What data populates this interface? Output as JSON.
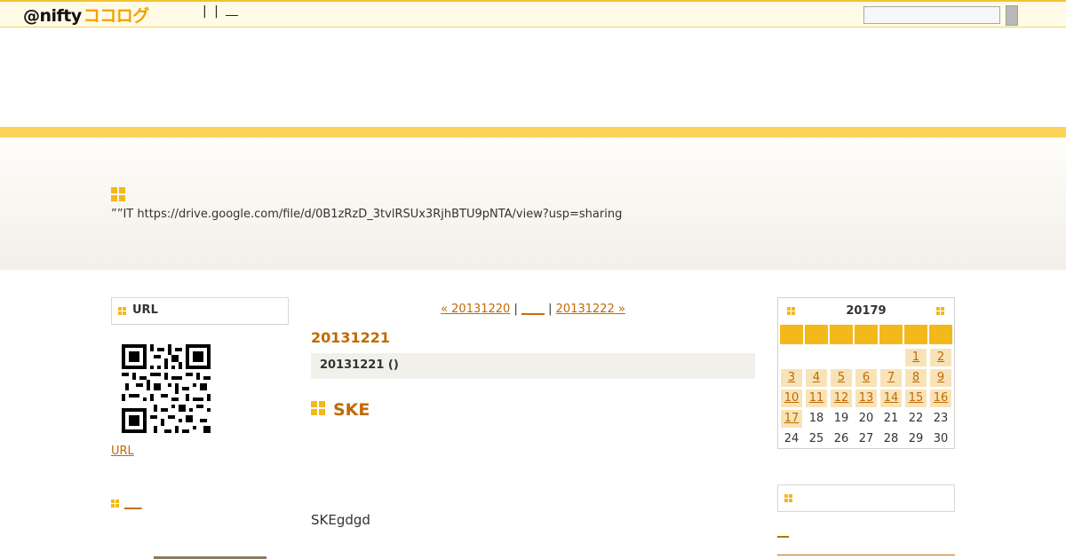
{
  "topbar": {
    "logo_prefix": "@nifty",
    "logo_brand": "ココログ",
    "links": [
      "|",
      "|"
    ],
    "search_placeholder": ""
  },
  "banner": {
    "description": "””IT  https://drive.google.com/file/d/0B1zRzD_3tvlRSUx3RjhBTU9pNTA/view?usp=sharing"
  },
  "left_sidebar": {
    "url_box_title": "URL",
    "qr_label": "qr-code",
    "url_link": "URL",
    "section2_link": "___"
  },
  "post": {
    "nav_prev": "« 20131220",
    "nav_sep1": " | ",
    "nav_main": "____",
    "nav_sep2": " | ",
    "nav_next": "20131222 » ",
    "date_heading": "20131221",
    "bar_text": "20131221 ()",
    "title": "SKE",
    "body": "SKEgdgd"
  },
  "calendar": {
    "title": "20179",
    "weeks": [
      [
        "",
        "",
        "",
        "",
        "",
        "1",
        "2"
      ],
      [
        "3",
        "4",
        "5",
        "6",
        "7",
        "8",
        "9"
      ],
      [
        "10",
        "11",
        "12",
        "13",
        "14",
        "15",
        "16"
      ],
      [
        "17",
        "18",
        "19",
        "20",
        "21",
        "22",
        "23"
      ],
      [
        "24",
        "25",
        "26",
        "27",
        "28",
        "29",
        "30"
      ]
    ],
    "linked_days": [
      "1",
      "2",
      "3",
      "4",
      "5",
      "6",
      "7",
      "8",
      "9",
      "10",
      "11",
      "12",
      "13",
      "14",
      "15",
      "16",
      "17"
    ]
  },
  "right_sidebar": {
    "section2_link": "__"
  },
  "colors": {
    "accent": "#f3b81a",
    "link": "#c06a00",
    "stripe": "#fdd35a"
  }
}
